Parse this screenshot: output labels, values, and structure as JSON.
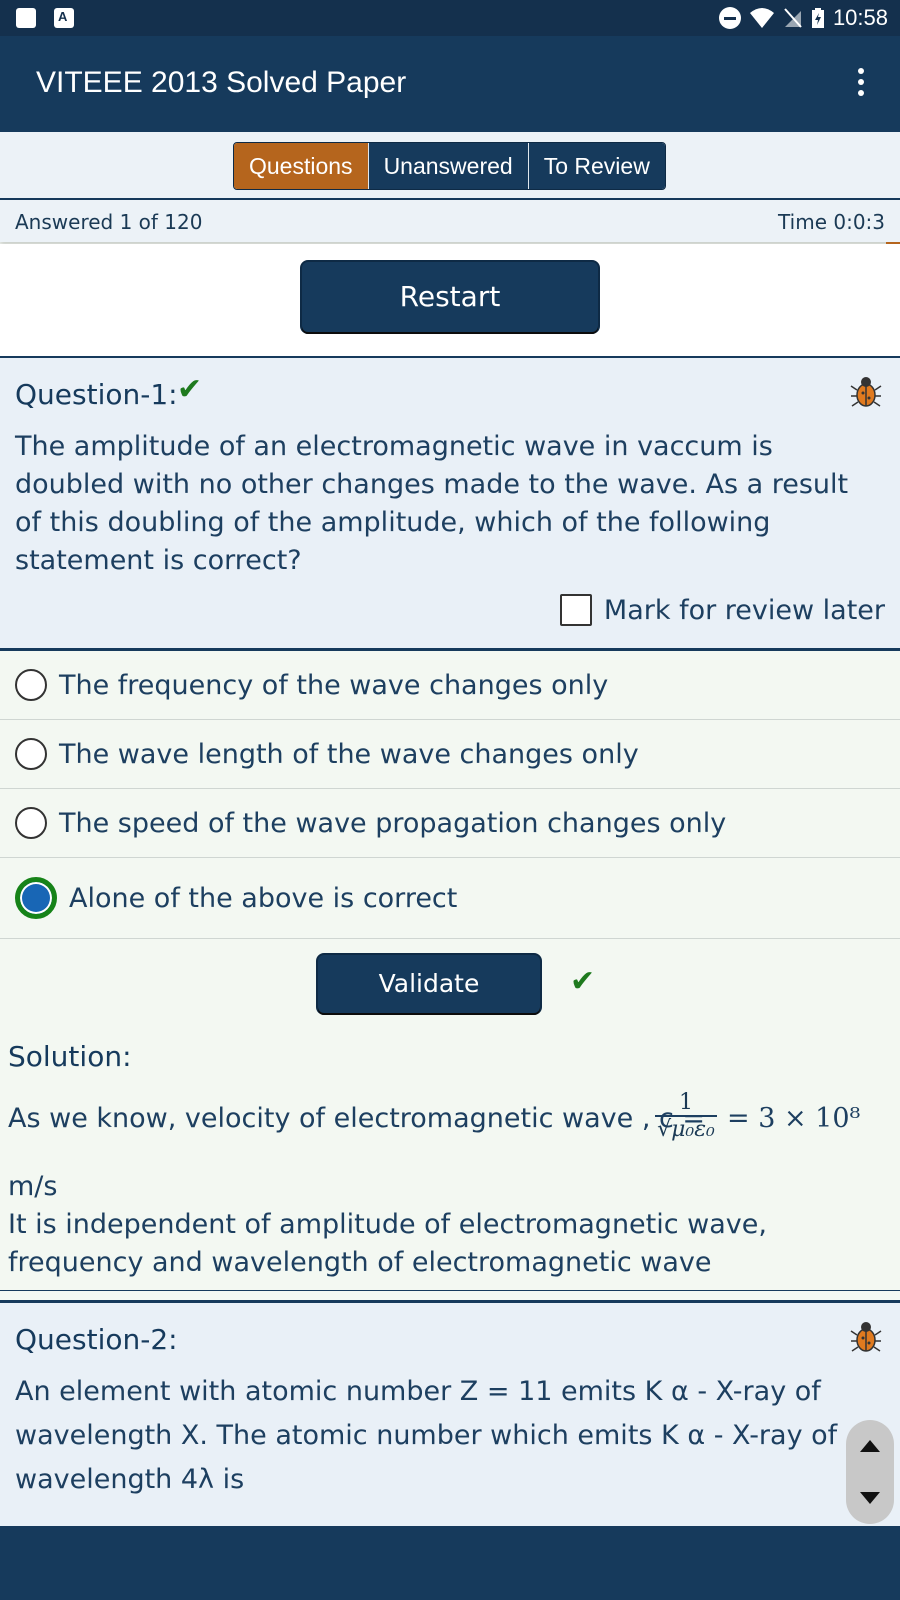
{
  "status_bar": {
    "time": "10:58"
  },
  "app_bar": {
    "title": "VITEEE 2013 Solved Paper"
  },
  "tabs": [
    {
      "label": "Questions"
    },
    {
      "label": "Unanswered"
    },
    {
      "label": "To Review"
    }
  ],
  "info": {
    "answered": "Answered 1 of 120",
    "time": "Time 0:0:3"
  },
  "restart_label": "Restart",
  "question1": {
    "label": "Question-1:",
    "text": "The amplitude of an electromagnetic wave in vaccum is doubled with no other changes made to the wave. As a result of this doubling of the amplitude, which of the following statement is correct?",
    "review_label": "Mark for review later",
    "options": [
      "The frequency of the wave changes only",
      "The wave length of the wave changes only",
      "The speed of the wave propagation changes only",
      "Alone of the above is correct"
    ],
    "validate_label": "Validate"
  },
  "solution": {
    "label": "Solution:",
    "line1_prefix": "As we know, velocity of electromagnetic wave , c =",
    "frac_num": "1",
    "frac_den": "√μ₀ε₀",
    "line1_suffix": "= 3 × 10⁸",
    "line2": "m/s",
    "line3": "It is independent of amplitude of electromagnetic wave, frequency and wavelength of electromagnetic wave"
  },
  "question2": {
    "label": "Question-2:",
    "line1": "An element with atomic number Z = 11 emits K α - X-ray of",
    "line2": "wavelength X. The atomic number which emits K α - X-ray of",
    "line3": "wavelength 4λ is"
  }
}
